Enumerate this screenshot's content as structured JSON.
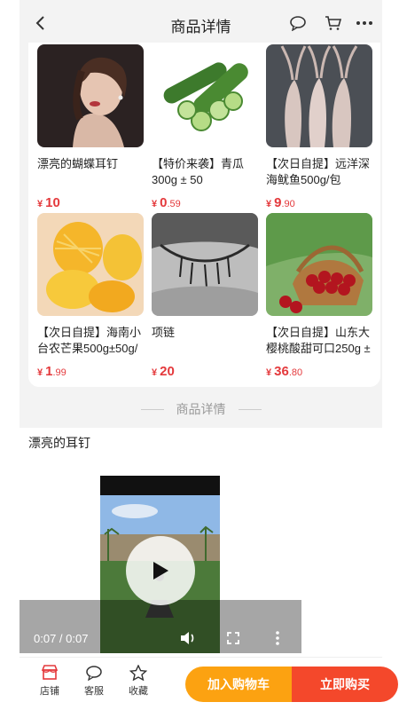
{
  "header": {
    "title": "商品详情"
  },
  "products": [
    {
      "name": "漂亮的蝴蝶耳钉",
      "currency": "¥",
      "price_int": "10",
      "price_dec": ""
    },
    {
      "name": "【特价来袭】青瓜300g ± 50",
      "currency": "¥",
      "price_int": "0",
      "price_dec": ".59"
    },
    {
      "name": "【次日自提】远洋深海鱿鱼500g/包",
      "currency": "¥",
      "price_int": "9",
      "price_dec": ".90"
    },
    {
      "name": "【次日自提】海南小台农芒果500g±50g/",
      "currency": "¥",
      "price_int": "1",
      "price_dec": ".99"
    },
    {
      "name": "项链",
      "currency": "¥",
      "price_int": "20",
      "price_dec": ""
    },
    {
      "name": "【次日自提】山东大樱桃酸甜可口250g ±",
      "currency": "¥",
      "price_int": "36",
      "price_dec": ".80"
    }
  ],
  "divider": {
    "label": "商品详情"
  },
  "detail": {
    "title": "漂亮的耳钉"
  },
  "video": {
    "time": "0:07 / 0:07",
    "progress": 1.0
  },
  "bottom": {
    "tabs": [
      "店铺",
      "客服",
      "收藏"
    ],
    "add_to_cart": "加入购物车",
    "buy_now": "立即购买"
  },
  "colors": {
    "price": "#e4393c",
    "cart_button": "#fca211",
    "buy_button": "#f4482b",
    "shop_icon": "#e4393c"
  },
  "icons": [
    "back-arrow-icon",
    "chat-bubble-icon",
    "shopping-cart-icon",
    "more-dots-icon",
    "shop-icon",
    "customer-service-icon",
    "star-icon",
    "play-icon",
    "volume-icon",
    "fullscreen-icon",
    "vertical-dots-icon"
  ]
}
